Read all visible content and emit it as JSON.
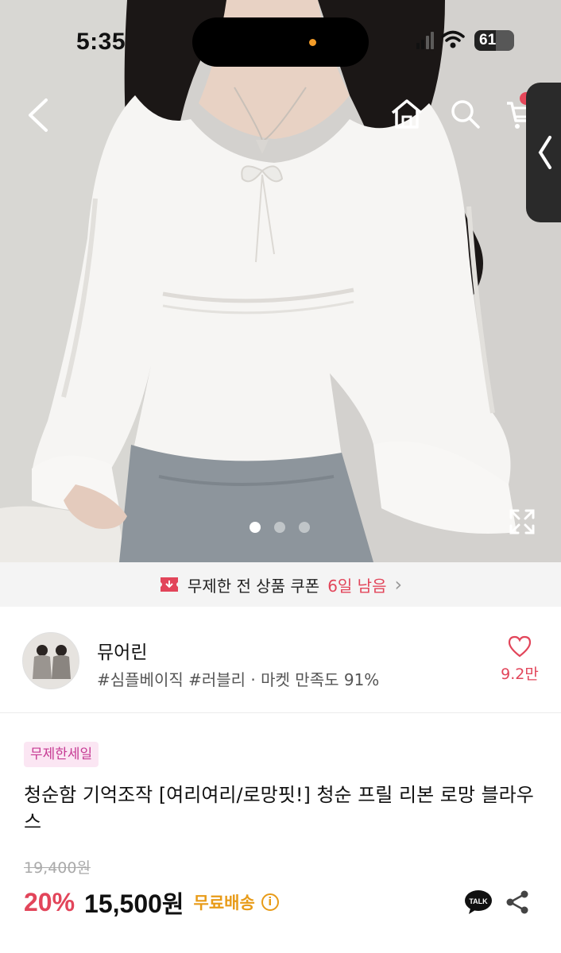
{
  "status_bar": {
    "time": "5:35",
    "battery": "61"
  },
  "gallery": {
    "slide_count": 3,
    "active_slide": 1
  },
  "coupon_banner": {
    "text": "무제한 전 상품 쿠폰",
    "highlight": "6일 남음"
  },
  "shop": {
    "name": "뮤어린",
    "tags": "#심플베이직 #러블리 · 마켓 만족도 91%",
    "likes": "9.2만"
  },
  "product": {
    "badge": "무제한세일",
    "title": "청순함 기억조작 [여리여리/로망핏!] 청순 프릴 리본 로망 블라우스",
    "original_price": "19,400원",
    "discount": "20%",
    "price_number": "15,500",
    "price_unit": "원",
    "shipping": "무료배송",
    "talk_label": "TALK"
  },
  "colors": {
    "accent": "#e2455a",
    "shipping": "#e89b18",
    "badge_bg": "#fbe6f3",
    "badge_text": "#c63a93"
  }
}
